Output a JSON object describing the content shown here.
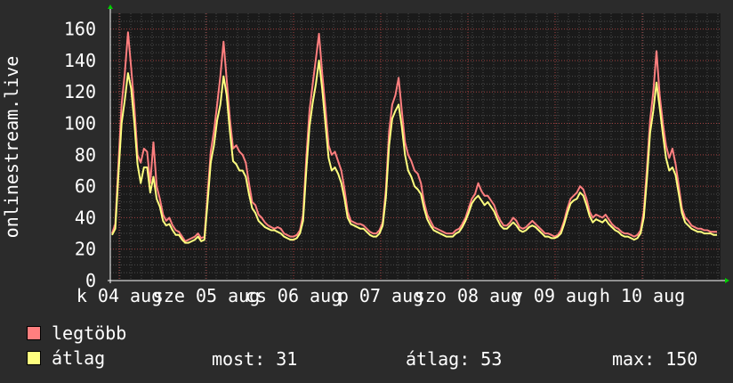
{
  "chart_data": {
    "type": "line",
    "ylabel": "onlinestream.live",
    "ylim": [
      0,
      170
    ],
    "y_ticks": [
      0,
      20,
      40,
      60,
      80,
      100,
      120,
      140,
      160
    ],
    "x_ticks": [
      "k 04 aug",
      "sze 05 aug",
      "cs 06 aug",
      "p 07 aug",
      "szo 08 aug",
      "v 09 aug",
      "h 10 aug"
    ],
    "grid": true,
    "legend_position": "bottom-left",
    "series": [
      {
        "name": "legtöbb",
        "color": "#ff7f7f",
        "values": [
          30,
          36,
          75,
          112,
          132,
          158,
          135,
          110,
          80,
          75,
          84,
          82,
          62,
          88,
          60,
          52,
          42,
          38,
          40,
          35,
          32,
          31,
          28,
          25,
          26,
          27,
          28,
          30,
          27,
          28,
          55,
          82,
          95,
          112,
          130,
          152,
          128,
          103,
          84,
          86,
          82,
          80,
          75,
          62,
          50,
          48,
          42,
          40,
          37,
          35,
          34,
          33,
          34,
          33,
          30,
          29,
          28,
          28,
          29,
          32,
          42,
          78,
          108,
          125,
          141,
          157,
          132,
          110,
          86,
          80,
          82,
          76,
          70,
          58,
          44,
          38,
          37,
          36,
          36,
          35,
          33,
          31,
          30,
          30,
          32,
          37,
          58,
          95,
          112,
          118,
          129,
          108,
          88,
          80,
          76,
          70,
          68,
          62,
          50,
          42,
          38,
          34,
          33,
          32,
          31,
          30,
          30,
          30,
          32,
          33,
          36,
          40,
          46,
          52,
          55,
          62,
          57,
          54,
          54,
          51,
          48,
          42,
          38,
          35,
          35,
          37,
          40,
          38,
          34,
          33,
          34,
          36,
          38,
          36,
          34,
          32,
          30,
          30,
          29,
          28,
          29,
          32,
          38,
          46,
          52,
          54,
          56,
          60,
          58,
          52,
          44,
          40,
          42,
          41,
          40,
          42,
          39,
          36,
          34,
          33,
          31,
          30,
          30,
          29,
          28,
          29,
          32,
          44,
          72,
          102,
          120,
          146,
          118,
          100,
          86,
          78,
          84,
          74,
          60,
          46,
          40,
          38,
          35,
          34,
          33,
          33,
          32,
          32,
          31,
          31,
          31
        ]
      },
      {
        "name": "átlag",
        "color": "#ffff7f",
        "values": [
          29,
          33,
          68,
          100,
          115,
          132,
          122,
          100,
          74,
          62,
          72,
          72,
          56,
          66,
          52,
          47,
          38,
          35,
          36,
          32,
          29,
          29,
          26,
          24,
          24,
          25,
          26,
          28,
          25,
          26,
          50,
          75,
          86,
          102,
          112,
          130,
          118,
          95,
          76,
          74,
          70,
          70,
          66,
          55,
          46,
          43,
          38,
          36,
          34,
          33,
          32,
          32,
          31,
          30,
          28,
          27,
          26,
          26,
          27,
          30,
          38,
          70,
          98,
          113,
          125,
          140,
          122,
          100,
          78,
          70,
          72,
          68,
          62,
          52,
          40,
          36,
          35,
          34,
          33,
          33,
          31,
          29,
          28,
          28,
          30,
          35,
          53,
          86,
          103,
          108,
          112,
          98,
          80,
          70,
          66,
          60,
          58,
          55,
          46,
          39,
          35,
          32,
          31,
          30,
          29,
          28,
          28,
          28,
          30,
          31,
          34,
          38,
          43,
          49,
          52,
          54,
          51,
          48,
          50,
          47,
          44,
          39,
          35,
          33,
          33,
          35,
          37,
          35,
          32,
          31,
          32,
          34,
          35,
          34,
          32,
          30,
          28,
          28,
          27,
          27,
          28,
          30,
          36,
          43,
          49,
          51,
          52,
          56,
          54,
          48,
          41,
          37,
          39,
          38,
          37,
          39,
          36,
          34,
          32,
          31,
          29,
          28,
          28,
          27,
          26,
          27,
          30,
          40,
          65,
          94,
          108,
          126,
          110,
          93,
          78,
          70,
          72,
          67,
          55,
          43,
          37,
          35,
          33,
          32,
          31,
          31,
          30,
          30,
          30,
          29,
          29
        ]
      }
    ]
  },
  "legend": [
    {
      "label": "legtöbb",
      "color": "#ff7f7f"
    },
    {
      "label": "átlag",
      "color": "#ffff7f"
    }
  ],
  "stats": {
    "now_label": "most:",
    "now_value": "31",
    "avg_label": "átlag:",
    "avg_value": "53",
    "max_label": "max:",
    "max_value": "150"
  }
}
